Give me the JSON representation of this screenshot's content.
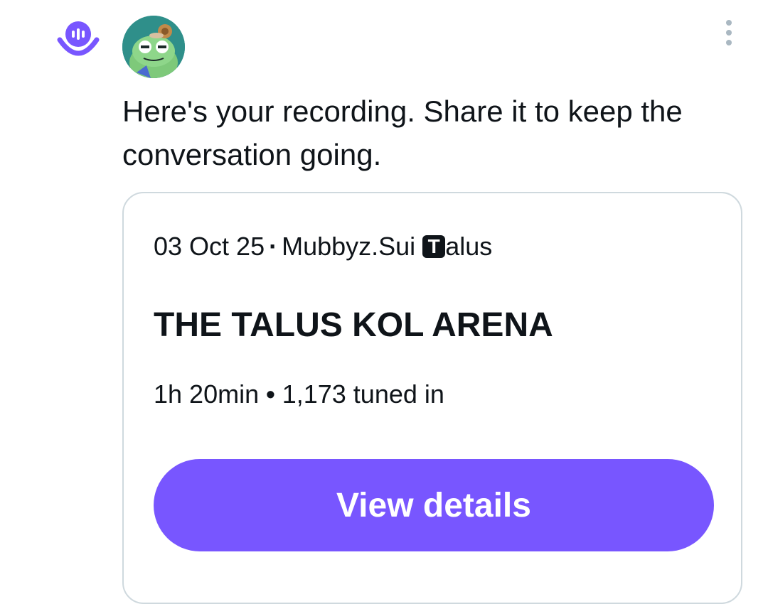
{
  "header": {
    "logo_icon": "spaces-logo-icon",
    "logo_color": "#7856ff",
    "avatar_icon": "frog-avatar",
    "more_icon": "more-vertical-icon"
  },
  "message": {
    "text": "Here's your recording. Share it to keep the conversation going."
  },
  "card": {
    "date": "03 Oct 25",
    "separator": "·",
    "host": "Mubbyz.Sui",
    "badge_letter": "T",
    "badge_text": "alus",
    "title": "THE TALUS KOL ARENA",
    "duration": "1h 20min",
    "stats_separator": "•",
    "listeners": "1,173 tuned in",
    "button_label": "View details",
    "button_color": "#7856ff"
  }
}
